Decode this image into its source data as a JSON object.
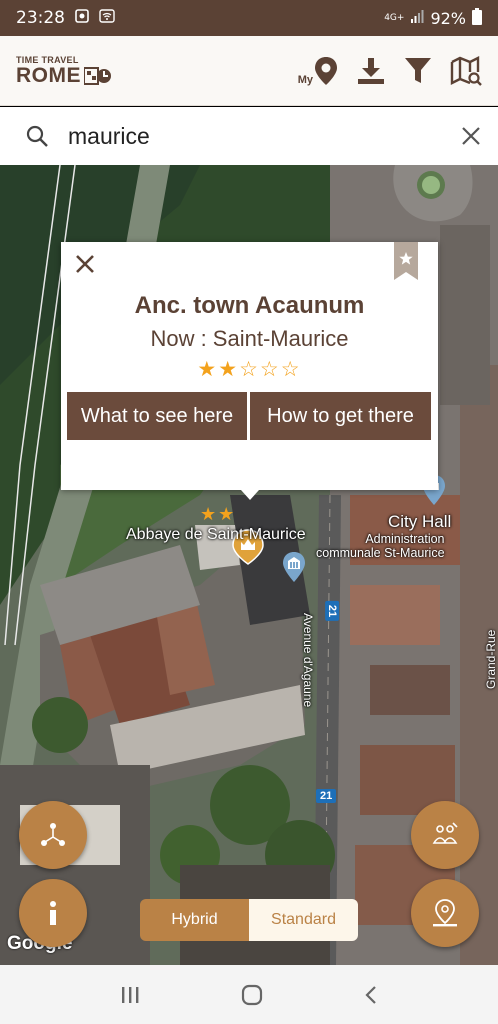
{
  "status_bar": {
    "time": "23:28",
    "network": "4G+",
    "battery": "92%",
    "icons": [
      "notification-icon",
      "wifi-icon",
      "signal-icon",
      "battery-icon"
    ]
  },
  "header": {
    "logo_top": "TIME TRAVEL",
    "logo_bottom": "ROME",
    "my_label": "My",
    "icons": [
      "my-location-icon",
      "download-icon",
      "filter-icon",
      "map-search-icon"
    ]
  },
  "search": {
    "value": "maurice",
    "placeholder": ""
  },
  "popup": {
    "title": "Anc. town Acaunum",
    "now": "Now :  Saint-Maurice",
    "rating": 2,
    "rating_max": 5,
    "btn_see": "What to see here",
    "btn_get": "How to get there"
  },
  "map": {
    "abbey": "Abbaye de Saint-Maurice",
    "city_hall": "City Hall",
    "admin": "Administration",
    "admin2": "communale St-Maurice",
    "avenue": "Avenue d'Agaune",
    "grand_rue": "Grand-Rue",
    "road_21": "21",
    "road_21b": "21",
    "google": "Google",
    "marker_rating": 2
  },
  "toggle": {
    "hybrid": "Hybrid",
    "standard": "Standard",
    "selected": "Hybrid"
  },
  "colors": {
    "brand_brown": "#5b4235",
    "button_brown": "#6b4b3c",
    "accent_gold": "#ba8246",
    "star": "#f3a21d"
  }
}
